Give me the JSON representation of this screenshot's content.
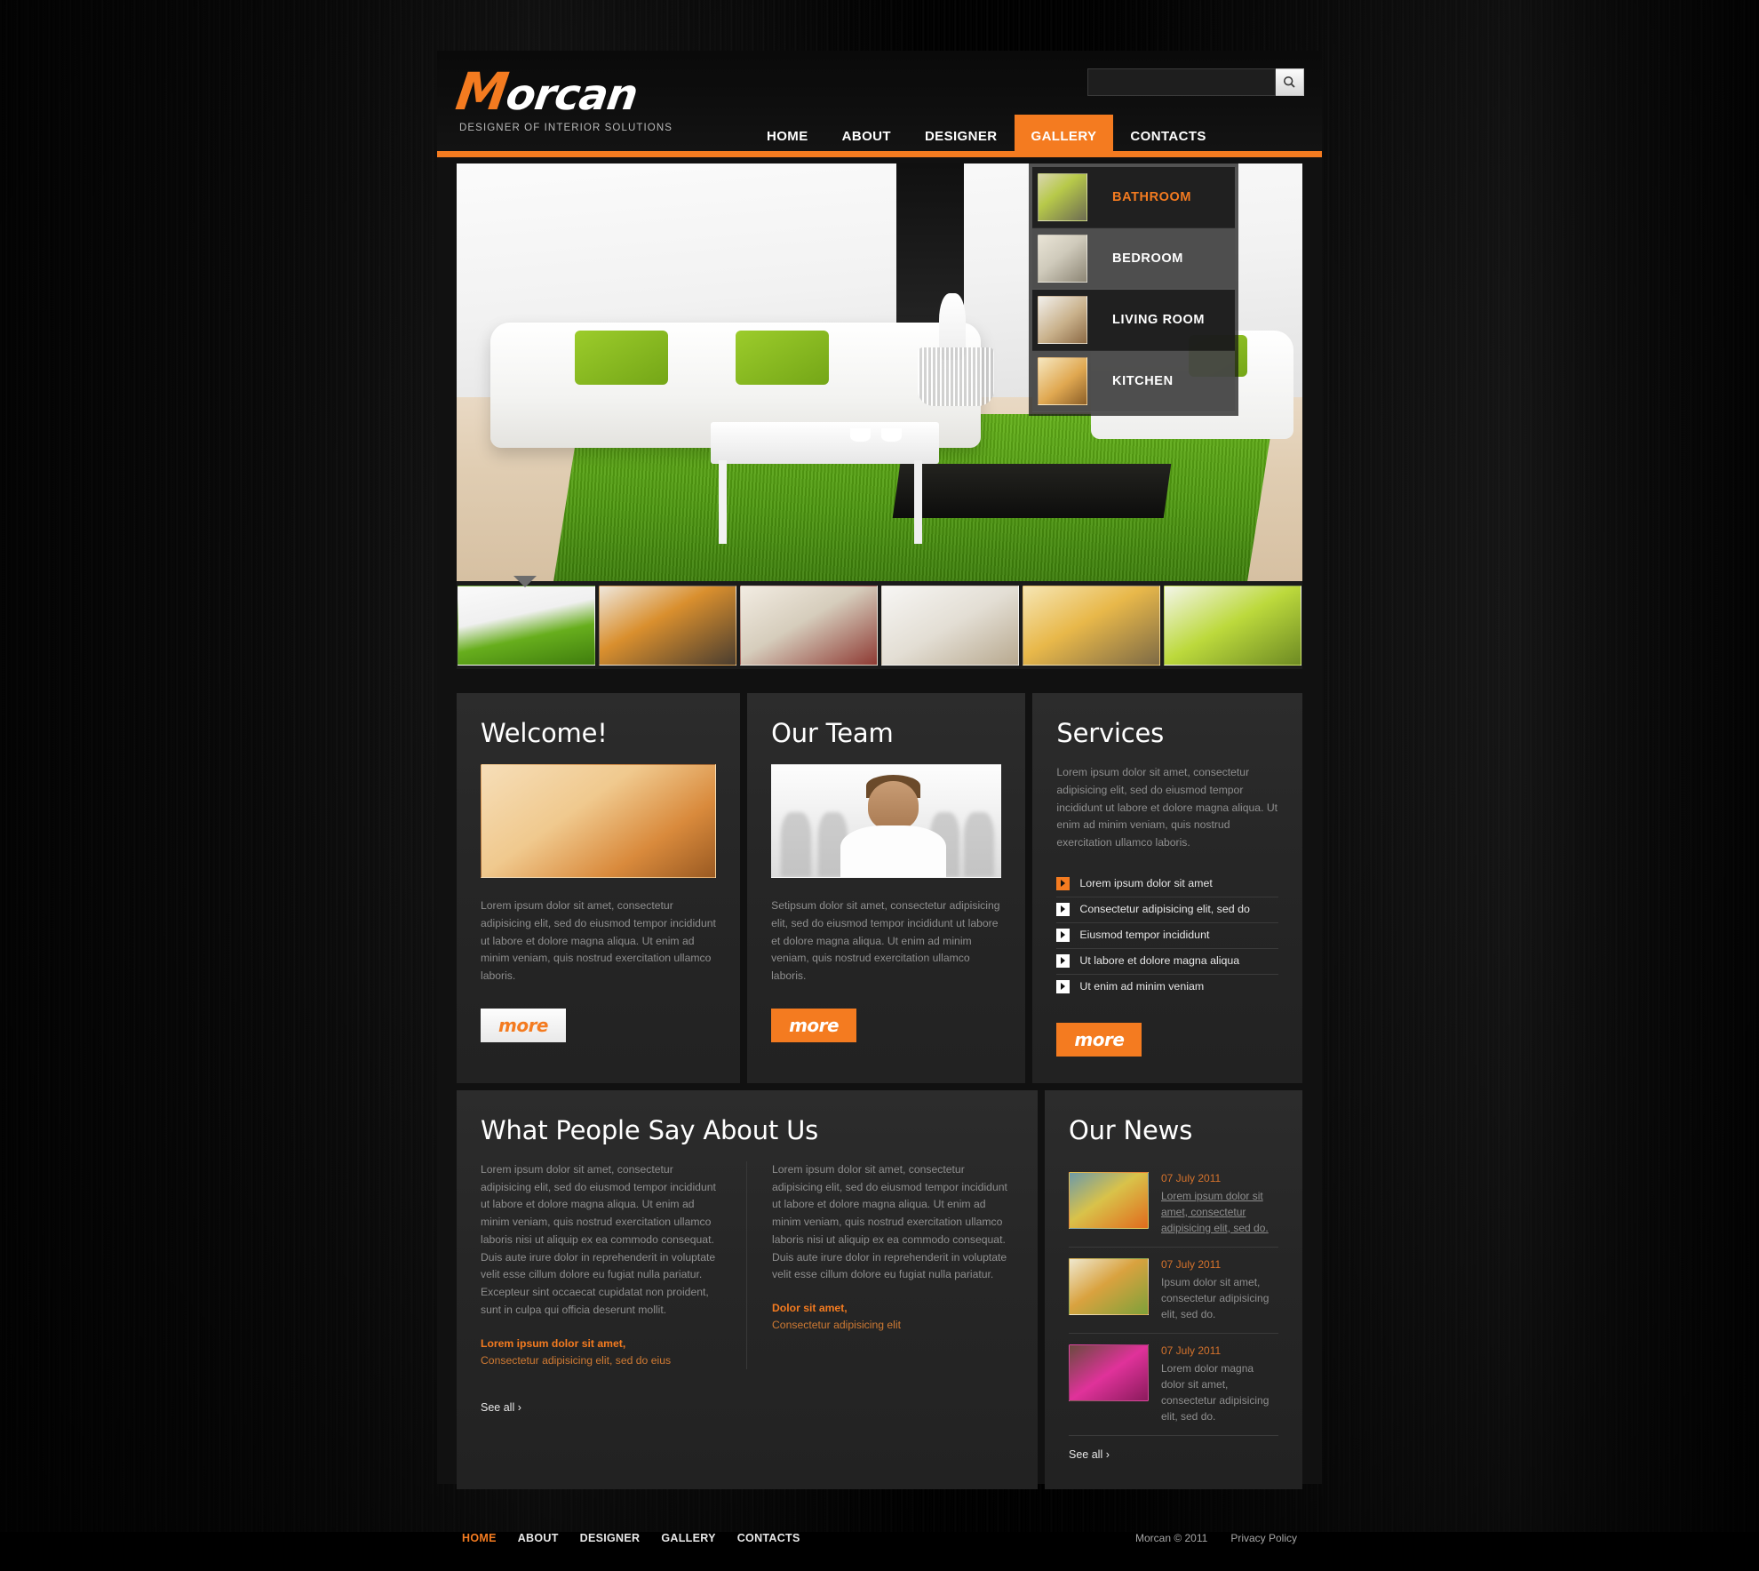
{
  "brand": {
    "logo_m": "M",
    "logo_rest": "orcan",
    "tagline": "DESIGNER OF INTERIOR SOLUTIONS",
    "accent_color": "#f47b20"
  },
  "search": {
    "value": "",
    "placeholder": "",
    "icon": "search-icon"
  },
  "nav": {
    "items": [
      {
        "label": "HOME",
        "active": false
      },
      {
        "label": "ABOUT",
        "active": false
      },
      {
        "label": "DESIGNER",
        "active": false
      },
      {
        "label": "GALLERY",
        "active": true
      },
      {
        "label": "CONTACTS",
        "active": false
      }
    ]
  },
  "gallery": {
    "categories": [
      {
        "label": "BATHROOM",
        "active": true
      },
      {
        "label": "BEDROOM",
        "active": false
      },
      {
        "label": "LIVING ROOM",
        "active": false
      },
      {
        "label": "KITCHEN",
        "active": false
      }
    ],
    "thumbnail_count": 6,
    "selected_thumbnail": 1
  },
  "welcome": {
    "title": "Welcome!",
    "text": "Lorem ipsum dolor sit amet, consectetur adipisicing elit, sed do eiusmod tempor incididunt ut labore et dolore magna aliqua. Ut enim ad minim veniam, quis nostrud exercitation ullamco laboris.",
    "more_label": "more"
  },
  "team": {
    "title": "Our Team",
    "text": "Setipsum dolor sit amet, consectetur adipisicing elit, sed do eiusmod tempor incididunt ut labore et dolore magna aliqua. Ut enim ad minim veniam, quis nostrud exercitation ullamco laboris.",
    "more_label": "more"
  },
  "services": {
    "title": "Services",
    "text": "Lorem ipsum dolor sit amet, consectetur adipisicing elit, sed do eiusmod tempor incididunt ut labore et dolore magna aliqua. Ut enim ad minim veniam, quis nostrud exercitation ullamco laboris.",
    "items": [
      {
        "label": "Lorem ipsum dolor sit amet",
        "active": true
      },
      {
        "label": "Consectetur adipisicing elit, sed do",
        "active": false
      },
      {
        "label": "Eiusmod tempor incididunt",
        "active": false
      },
      {
        "label": "Ut labore et dolore magna aliqua",
        "active": false
      },
      {
        "label": "Ut enim ad minim veniam",
        "active": false
      }
    ],
    "more_label": "more"
  },
  "testimonials": {
    "title": "What People Say About Us",
    "items": [
      {
        "text": "Lorem ipsum dolor sit amet, consectetur adipisicing elit, sed do eiusmod tempor incididunt ut labore et dolore magna aliqua. Ut enim ad minim veniam, quis nostrud exercitation ullamco laboris nisi ut aliquip ex ea commodo consequat. Duis aute irure dolor in reprehenderit in voluptate velit esse cillum dolore eu fugiat nulla pariatur. Excepteur sint occaecat cupidatat non proident, sunt in culpa qui officia deserunt mollit.",
        "name": "Lorem ipsum dolor sit amet,",
        "role": "Consectetur adipisicing elit, sed do eius"
      },
      {
        "text": "Lorem ipsum dolor sit amet, consectetur adipisicing elit, sed do eiusmod tempor incididunt ut labore et dolore magna aliqua. Ut enim ad minim veniam, quis nostrud exercitation ullamco laboris nisi ut aliquip ex ea commodo consequat. Duis aute irure dolor in reprehenderit in voluptate velit esse cillum dolore eu fugiat nulla pariatur.",
        "name": "Dolor sit amet,",
        "role": "Consectetur adipisicing elit"
      }
    ],
    "see_all_label": "See all ›"
  },
  "news": {
    "title": "Our News",
    "items": [
      {
        "date": "07 July 2011",
        "text": "Lorem ipsum dolor sit amet, consectetur adipisicing elit, sed do."
      },
      {
        "date": "07 July 2011",
        "text": "Ipsum dolor sit amet, consectetur adipisicing elit, sed do."
      },
      {
        "date": "07 July 2011",
        "text": "Lorem dolor magna dolor sit amet, consectetur adipisicing elit, sed do."
      }
    ],
    "see_all_label": "See all ›"
  },
  "footer": {
    "links": [
      {
        "label": "HOME",
        "active": true
      },
      {
        "label": "ABOUT",
        "active": false
      },
      {
        "label": "DESIGNER",
        "active": false
      },
      {
        "label": "GALLERY",
        "active": false
      },
      {
        "label": "CONTACTS",
        "active": false
      }
    ],
    "copyright": "Morcan © 2011",
    "privacy": "Privacy Policy"
  }
}
